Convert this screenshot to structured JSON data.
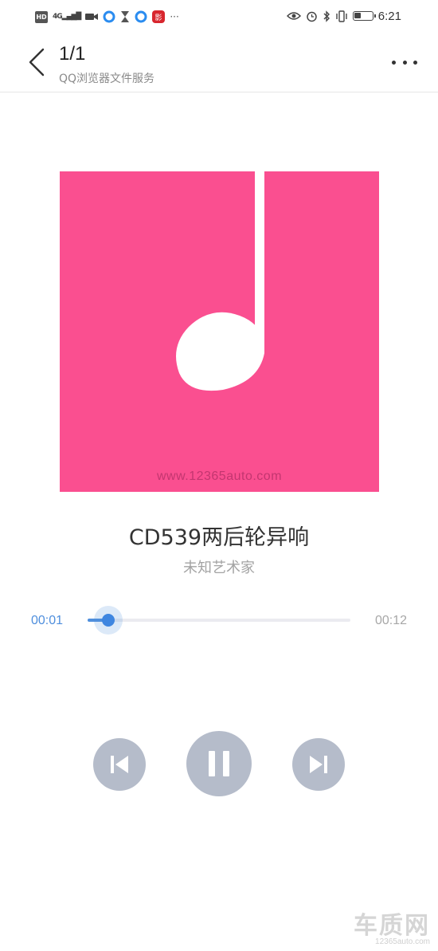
{
  "status_bar": {
    "hd": "HD",
    "network": "4G",
    "time": "6:21",
    "battery_level": 0.4,
    "icons": [
      "video-camera-icon",
      "browser-icon",
      "hourglass-icon",
      "browser-icon",
      "app-icon",
      "more-dots-icon",
      "eye-icon",
      "alarm-icon",
      "bluetooth-icon",
      "vibrate-icon",
      "battery-icon"
    ]
  },
  "header": {
    "title": "1/1",
    "subtitle": "QQ浏览器文件服务"
  },
  "cover": {
    "color": "#fa4f90",
    "icon": "music-note-icon",
    "watermark": "www.12365auto.com"
  },
  "song": {
    "title": "CD539两后轮异响",
    "artist": "未知艺术家"
  },
  "progress": {
    "current": "00:01",
    "total": "00:12",
    "fraction": 0.08,
    "color": "#4f8fdd"
  },
  "controls": {
    "prev_icon": "skip-previous-icon",
    "pause_icon": "pause-icon",
    "next_icon": "skip-next-icon",
    "color": "#b5bcca"
  },
  "corner_logo": {
    "big": "车质网",
    "small": "12365auto.com"
  }
}
